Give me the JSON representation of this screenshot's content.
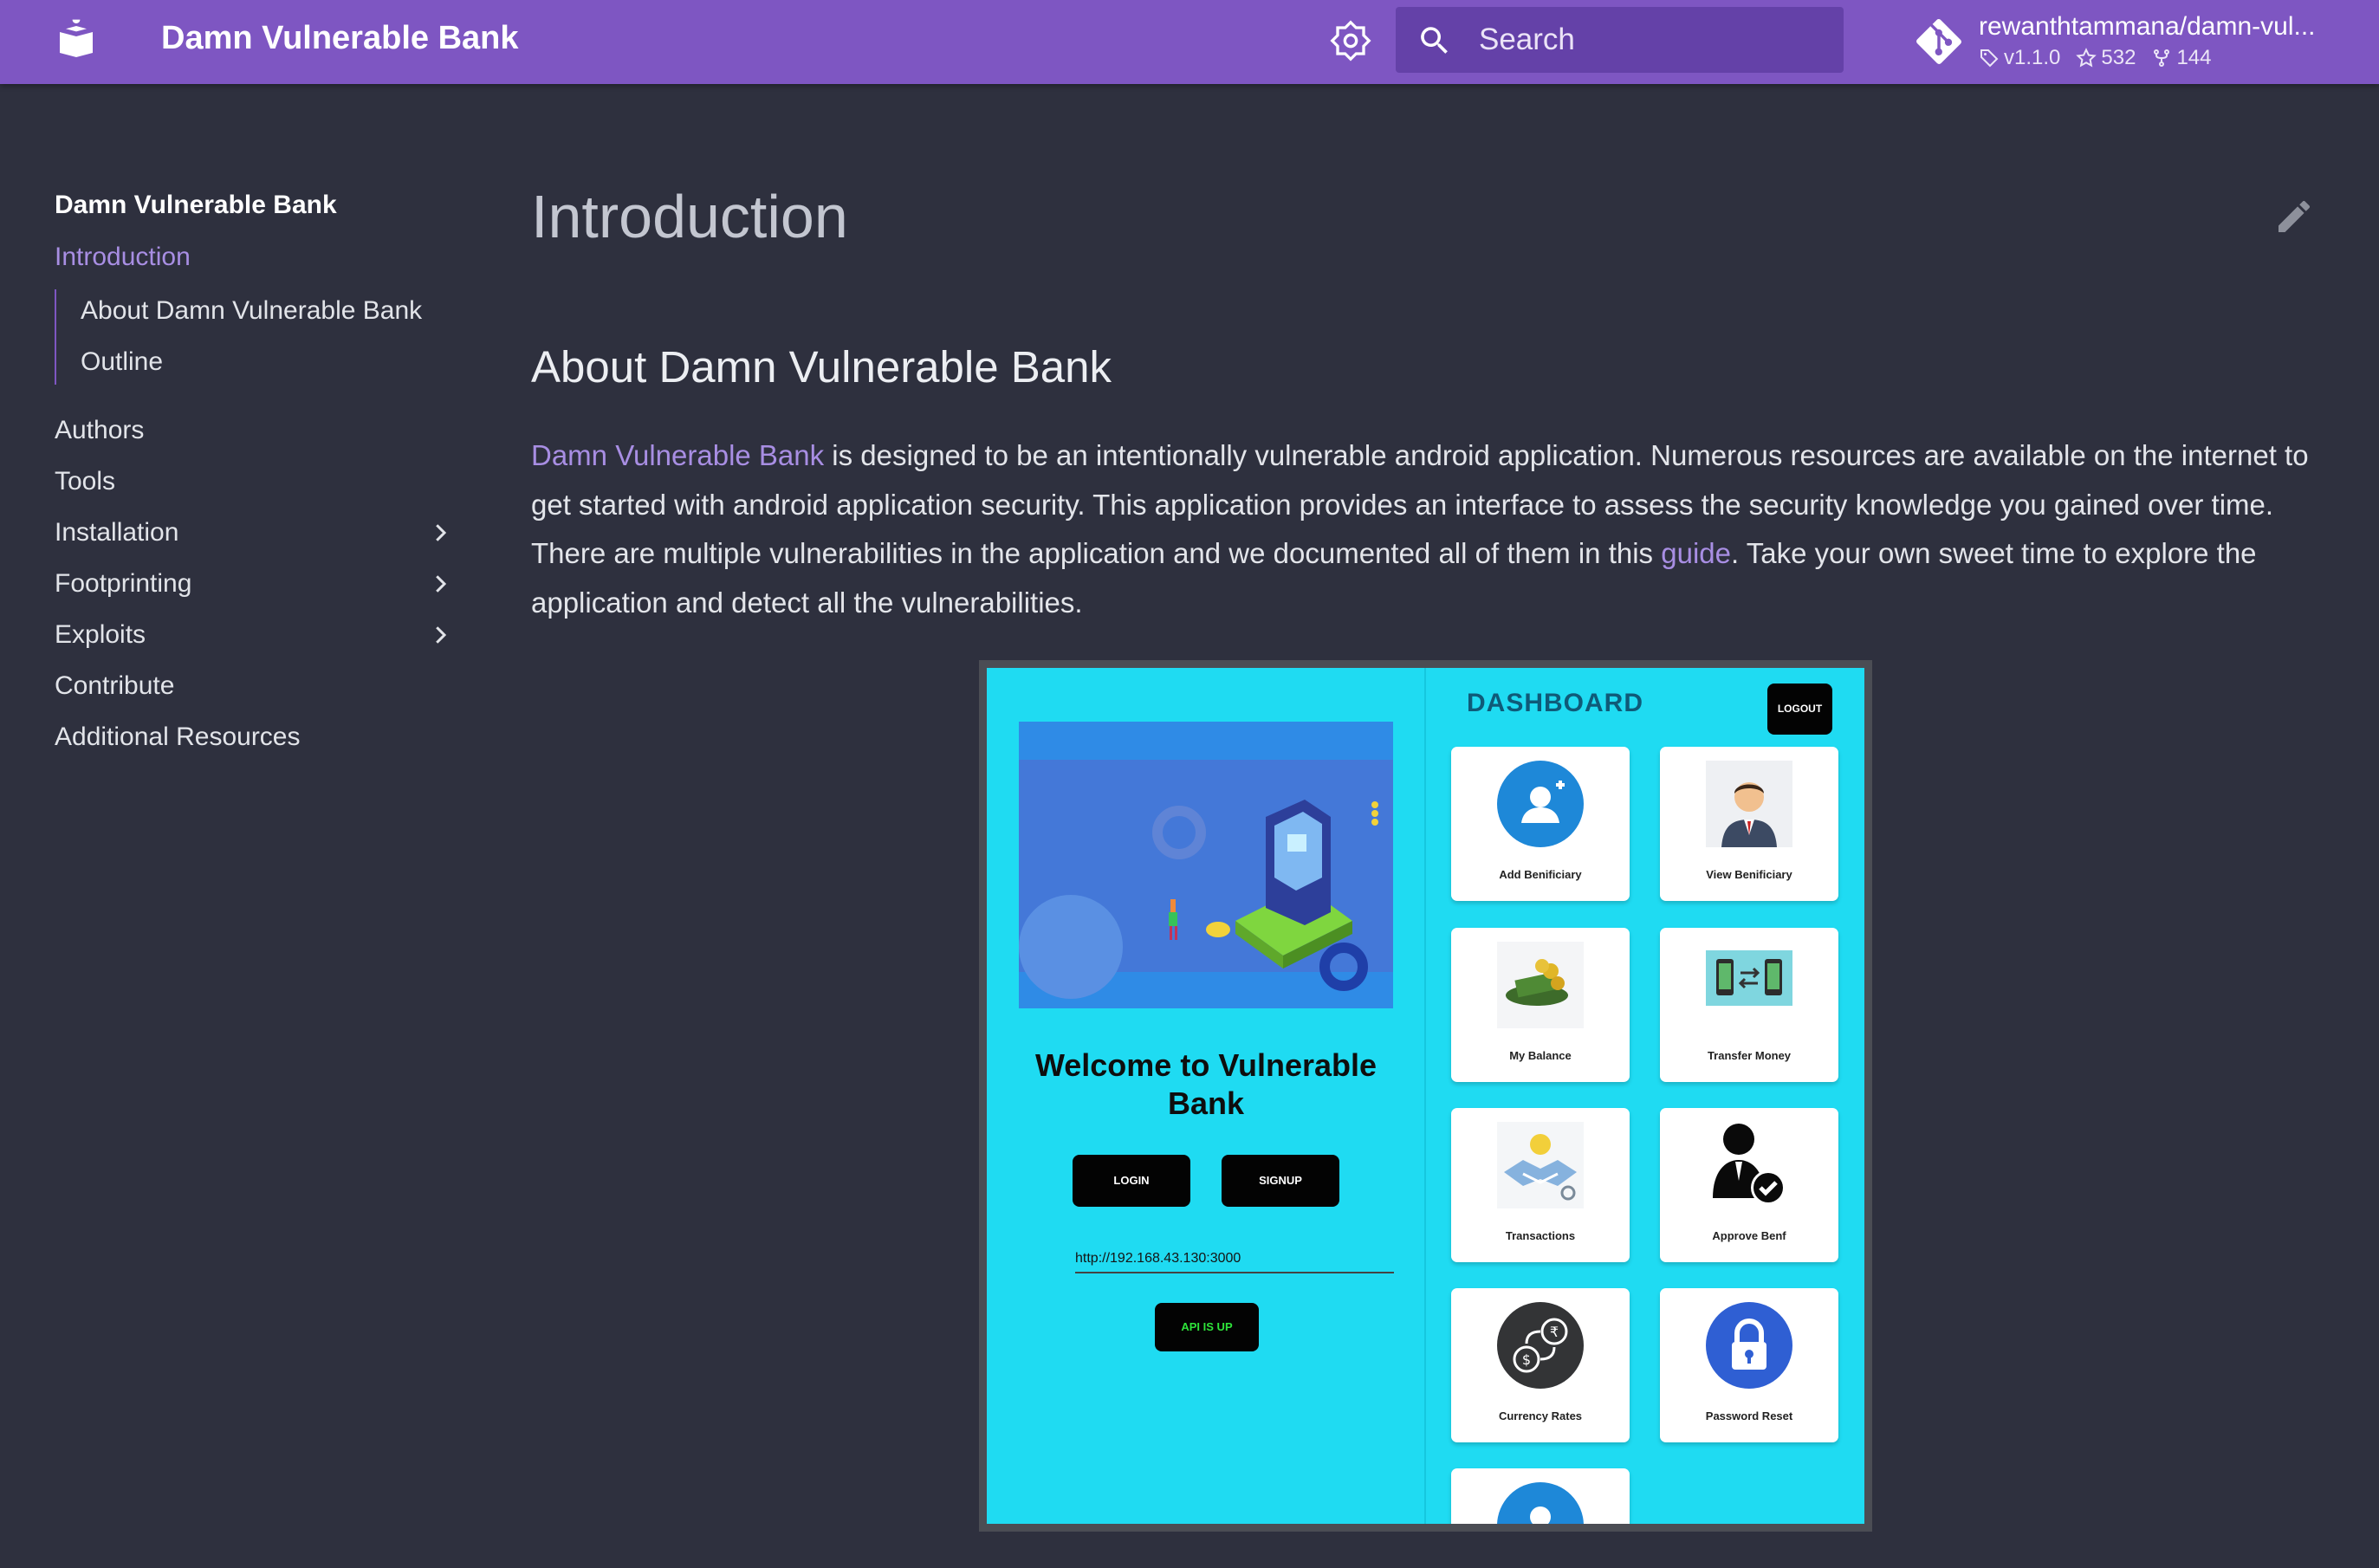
{
  "header": {
    "site_title": "Damn Vulnerable Bank",
    "search_placeholder": "Search",
    "repo": {
      "name": "rewanthtammana/damn-vul...",
      "version": "v1.1.0",
      "stars": "532",
      "forks": "144"
    },
    "colors": {
      "primary": "#7e56c2",
      "accent": "#a88ee3",
      "background": "#2e303e"
    }
  },
  "sidebar": {
    "heading": "Damn Vulnerable Bank",
    "active": "Introduction",
    "toc": [
      "About Damn Vulnerable Bank",
      "Outline"
    ],
    "items": [
      {
        "label": "Authors",
        "expandable": false
      },
      {
        "label": "Tools",
        "expandable": false
      },
      {
        "label": "Installation",
        "expandable": true
      },
      {
        "label": "Footprinting",
        "expandable": true
      },
      {
        "label": "Exploits",
        "expandable": true
      },
      {
        "label": "Contribute",
        "expandable": false
      },
      {
        "label": "Additional Resources",
        "expandable": false
      }
    ]
  },
  "main": {
    "title": "Introduction",
    "section_heading": "About Damn Vulnerable Bank",
    "paragraph": {
      "link1": "Damn Vulnerable Bank",
      "text1": " is designed to be an intentionally vulnerable android application. Numerous resources are available on the internet to get started with android application security. This application provides an interface to assess the security knowledge you gained over time. There are multiple vulnerabilities in the application and we documented all of them in this ",
      "link2": "guide",
      "text2": ". Take your own sweet time to explore the application and detect all the vulnerabilities."
    }
  },
  "app_screenshot": {
    "welcome": "Welcome to Vulnerable Bank",
    "login": "LOGIN",
    "signup": "SIGNUP",
    "url": "http://192.168.43.130:3000",
    "api_status": "API IS UP",
    "dashboard_title": "DASHBOARD",
    "logout": "LOGOUT",
    "cards": [
      {
        "label": "Add Benificiary",
        "icon": "add-user-icon"
      },
      {
        "label": "View Benificiary",
        "icon": "person-icon"
      },
      {
        "label": "My Balance",
        "icon": "money-icon"
      },
      {
        "label": "Transfer Money",
        "icon": "transfer-icon"
      },
      {
        "label": "Transactions",
        "icon": "handshake-icon"
      },
      {
        "label": "Approve Benf",
        "icon": "approve-user-icon"
      },
      {
        "label": "Currency Rates",
        "icon": "currency-icon"
      },
      {
        "label": "Password Reset",
        "icon": "lock-icon"
      }
    ]
  }
}
